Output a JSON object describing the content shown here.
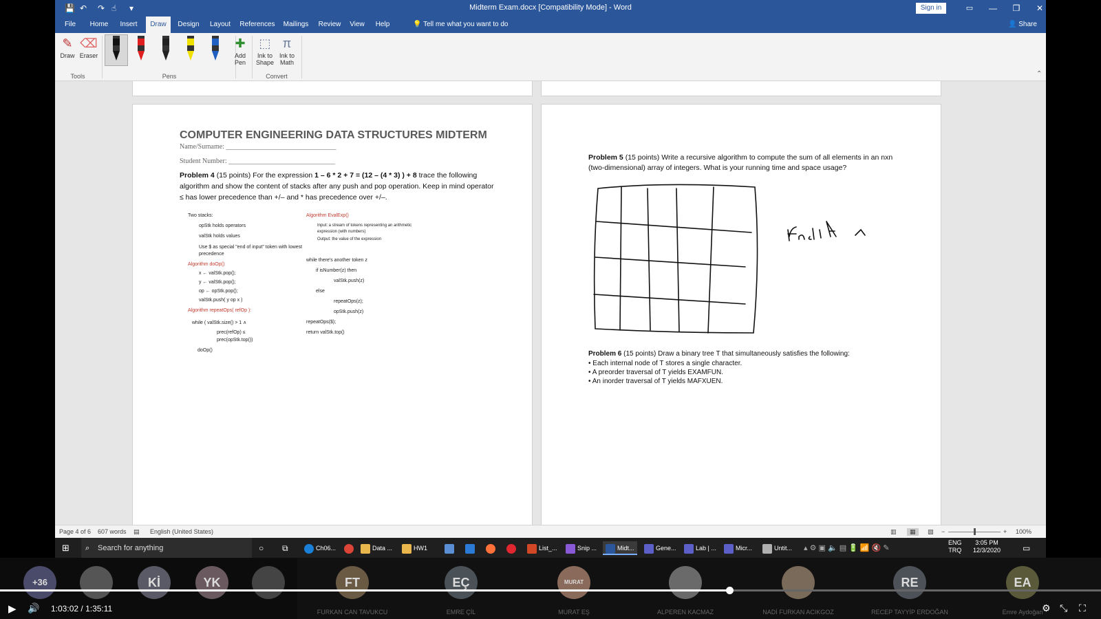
{
  "window": {
    "title": "Midterm Exam.docx [Compatibility Mode] - Word",
    "signin_label": "Sign in",
    "minimize": "—",
    "restore": "❐",
    "close": "✕"
  },
  "qat": {
    "save": "💾",
    "undo": "↶",
    "redo": "↷",
    "touch": "☝",
    "more": "▾"
  },
  "tabs": [
    "File",
    "Home",
    "Insert",
    "Draw",
    "Design",
    "Layout",
    "References",
    "Mailings",
    "Review",
    "View",
    "Help"
  ],
  "tell_me": "Tell me what you want to do",
  "share_label": "Share",
  "ribbon": {
    "draw_label": "Draw",
    "eraser_label": "Eraser",
    "tools_group": "Tools",
    "pens_group": "Pens",
    "add_pen_label": "Add Pen",
    "ink_to_shape_label": "Ink to Shape",
    "ink_to_math_label": "Ink to Math",
    "convert_group": "Convert",
    "pen_colors": [
      "#111111",
      "#e02020",
      "#222222",
      "#f0e000",
      "#2060c0"
    ]
  },
  "left_page": {
    "heading": "COMPUTER ENGINEERING DATA STRUCTURES MIDTERM",
    "name_label": "Name/Surname: ________________________________",
    "student_label": "Student Number: _______________________________",
    "p4_bold": "Problem 4",
    "p4_text": " (15 points) For the expression ",
    "p4_expr": "1 – 6 * 2 + 7 = (12 – (4 * 3) ) + 8",
    "p4_text2": " trace the following algorithm and show the content of stacks after any push and pop operation. Keep in mind operator ≤ has lower precedence than +/– and * has precedence over +/–.",
    "left_col": [
      "Two stacks:",
      "opStk holds operators",
      "valStk holds values",
      "Use $ as special \"end of input\" token with lowest precedence",
      "Algorithm doOp()",
      "x ← valStk.pop();",
      "y ← valStk.pop();",
      "op ← opStk.pop();",
      "valStk.push( y op x )",
      "Algorithm repeatOps( refOp ):",
      "while ( valStk.size() > 1 ∧",
      "prec(refOp) ≤",
      "prec(opStk.top())",
      "doOp()"
    ],
    "right_col": [
      "Algorithm EvalExp()",
      "Input: a stream of tokens representing an arithmetic expression (with numbers)",
      "Output: the value of the expression",
      "while there's another token z",
      "if isNumber(z) then",
      "valStk.push(z)",
      "else",
      "repeatOps(z);",
      "opStk.push(z)",
      "repeatOps($);",
      "return valStk.top()"
    ]
  },
  "right_page": {
    "p5_bold": "Problem 5",
    "p5_text": " (15 points) Write a recursive algorithm to compute the sum of all elements in an nxn (two-dimensional) array of integers. What is your running time and space usage?",
    "p6_bold": "Problem 6",
    "p6_text": " (15 points) Draw a binary tree T that simultaneously satisfies the following:",
    "bullets": [
      "• Each internal node of T stores a single character.",
      "• A preorder traversal of T yields EXAMFUN.",
      "• An inorder traversal of T yields MAFXUEN."
    ]
  },
  "status": {
    "page": "Page 4 of 6",
    "words": "607 words",
    "language": "English (United States)",
    "zoom": "100%",
    "zoom_level": 0.5
  },
  "taskbar": {
    "search_placeholder": "Search for anything",
    "apps": [
      "Ch06...",
      "Data ...",
      "HW1",
      "List_...",
      "Snip ...",
      "Midt...",
      "Gene...",
      "Lab | ...",
      "Micr...",
      "Untit..."
    ],
    "lang_1": "ENG",
    "lang_2": "TRQ",
    "time": "3:05 PM",
    "date": "12/3/2020"
  },
  "meeting": {
    "more_count": "+36",
    "participants": [
      {
        "initials": "Kİ",
        "name": ""
      },
      {
        "initials": "YK",
        "name": ""
      },
      {
        "initials": "FT",
        "name": "FURKAN CAN TAVUKCU"
      },
      {
        "initials": "EÇ",
        "name": "EMRE ÇİL"
      },
      {
        "initials": "MURAT",
        "name": "MURAT EŞ"
      },
      {
        "initials": "",
        "name": "ALPEREN KACMAZ"
      },
      {
        "initials": "",
        "name": "NADİ FURKAN ACIKGOZ"
      },
      {
        "initials": "RE",
        "name": "RECEP TAYYİP ERDOĞAN"
      },
      {
        "initials": "EA",
        "name": "Emre Aydoğan"
      }
    ]
  },
  "player": {
    "current": "1:03:02",
    "total": "1:35:11",
    "separator": "/",
    "progress": 0.6625
  }
}
